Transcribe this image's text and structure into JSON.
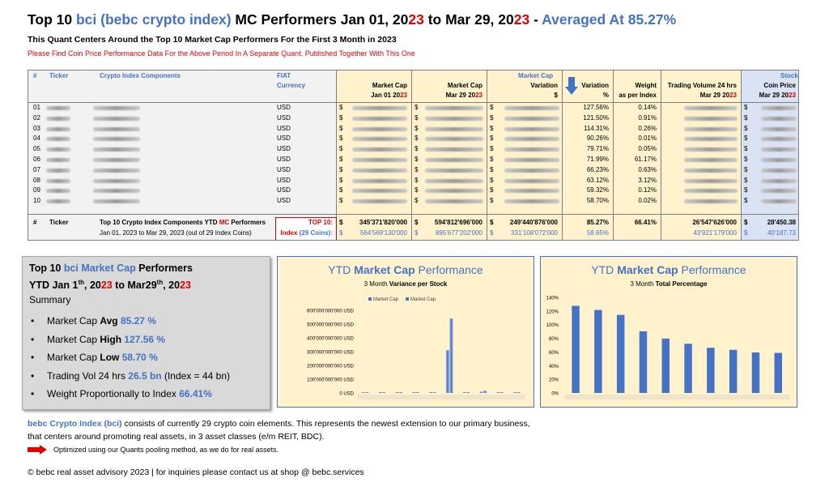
{
  "title": {
    "part1": "Top 10 ",
    "bci": "bci (bebc crypto index)",
    "part2": " MC Performers Jan 01, 20",
    "y1": "23",
    "part3": " to Mar 29, 20",
    "y2": "23",
    "part4": " - ",
    "avg": "Averaged At 85.27%"
  },
  "subtitle": "This Quant Centers Around the Top 10 Market Cap Performers For the First 3 Month in 2023",
  "note": "Please Find Coin Price Performance Data For the Above Period In A Separate Quant, Published Together With This One",
  "table": {
    "h_num": "#",
    "h_ticker": "Ticker",
    "h_components": "Crypto Index Components",
    "h_fiat1": "FIAT",
    "h_fiat2": "Currency",
    "h_group_mc": "Market Cap",
    "h_mc_jan1": "Market Cap",
    "h_mc_jan2a": "Jan 01 20",
    "h_mc_jan2b": "23",
    "h_mc_mar1": "Market Cap",
    "h_mc_mar2a": "Mar 29 20",
    "h_mc_mar2b": "23",
    "h_var_abs1": "Variation",
    "h_var_abs2": "$",
    "h_var_pct1": "Variation",
    "h_var_pct2": "%",
    "h_weight1": "Weight",
    "h_weight2": "as per Index",
    "h_vol1": "Trading Volume 24 hrs",
    "h_vol2a": "Mar 29 20",
    "h_vol2b": "23",
    "h_stock": "Stock",
    "h_price1": "Coin Price",
    "h_price2a": "Mar 29 20",
    "h_price2b": "23",
    "currency_sign": "$",
    "rows": [
      {
        "num": "01",
        "fiat": "USD",
        "var": "127.56%",
        "weight": "0.14%"
      },
      {
        "num": "02",
        "fiat": "USD",
        "var": "121.50%",
        "weight": "0.91%"
      },
      {
        "num": "03",
        "fiat": "USD",
        "var": "114.31%",
        "weight": "0.26%"
      },
      {
        "num": "04",
        "fiat": "USD",
        "var": "90.26%",
        "weight": "0.01%"
      },
      {
        "num": "05",
        "fiat": "USD",
        "var": "79.71%",
        "weight": "0.05%"
      },
      {
        "num": "06",
        "fiat": "USD",
        "var": "71.99%",
        "weight": "61.17%"
      },
      {
        "num": "07",
        "fiat": "USD",
        "var": "66.23%",
        "weight": "0.63%"
      },
      {
        "num": "08",
        "fiat": "USD",
        "var": "63.12%",
        "weight": "3.12%"
      },
      {
        "num": "09",
        "fiat": "USD",
        "var": "59.32%",
        "weight": "0.12%"
      },
      {
        "num": "10",
        "fiat": "USD",
        "var": "58.70%",
        "weight": "0.02%"
      }
    ],
    "foot_num": "#",
    "foot_ticker": "Ticker",
    "foot_desc1a": "Top 10 Crypto Index Components YTD ",
    "foot_desc1b": "MC",
    "foot_desc1c": " Performers",
    "foot_desc2": "Jan 01, 2023 to Mar 29, 2023 (out of 29 Index Coins)",
    "top10_label": "TOP 10:",
    "top10": {
      "mc_jan": "345'371'820'000",
      "mc_mar": "594'812'696'000",
      "var_abs": "249'440'876'000",
      "var_pct": "85.27%",
      "weight": "66.41%",
      "volume": "26'547'626'000",
      "price": "28'450.38"
    },
    "index_label_a": "Index",
    "index_label_b": "(29 Coins):",
    "index": {
      "mc_jan": "564'569'130'000",
      "mc_mar": "895'677'202'000",
      "var_abs": "331'108'072'000",
      "var_pct": "58.65%",
      "volume": "43'921'179'000",
      "price": "40'187.73"
    }
  },
  "summary": {
    "h1a": "Top 10 ",
    "h1b": "bci",
    "h1c": " Market Cap",
    "h1d": " Performers",
    "h2a": "YTD Jan 1",
    "h2a_sup": "th",
    "h2b": ", 20",
    "h2b_red": "23",
    "h2c": " to Mar29",
    "h2c_sup": "th",
    "h2d": ", 20",
    "h2d_red": "23",
    "label": "Summary",
    "bullets": [
      {
        "pre": "Market Cap ",
        "bold": "Avg",
        "val": "85.27 %",
        "post": ""
      },
      {
        "pre": "Market Cap ",
        "bold": "High",
        "val": "127.56 %",
        "post": ""
      },
      {
        "pre": "Market Cap ",
        "bold": "Low",
        "val": "58.70 %",
        "post": ""
      },
      {
        "pre": "Trading Vol 24 hrs ",
        "bold": "",
        "val": "26.5 bn",
        "post": " (Index = 44 bn)"
      },
      {
        "pre": "Weight Proportionally  to Index ",
        "bold": "",
        "val": "66.41%",
        "post": ""
      }
    ]
  },
  "chart_data": [
    {
      "type": "bar",
      "title": "YTD Market Cap Performance",
      "subtitle": "3 Month Variance per Stock",
      "legend": [
        "Market Cap",
        "Market Cap"
      ],
      "yticks": [
        "0 USD",
        "100'000'000'000 USD",
        "200'000'000'000 USD",
        "300'000'000'000 USD",
        "400'000'000'000 USD",
        "500'000'000'000 USD",
        "600'000'000'000 USD"
      ],
      "ylim": [
        0,
        600000000000
      ],
      "series": [
        {
          "values": [
            2000000000,
            1500000000,
            1000000000,
            800000000,
            1000000000,
            310000000000,
            2000000000,
            9000000000,
            1500000000,
            1000000000
          ]
        },
        {
          "values": [
            3000000000,
            2500000000,
            2000000000,
            1500000000,
            2000000000,
            540000000000,
            3000000000,
            16000000000,
            2500000000,
            2000000000
          ]
        }
      ]
    },
    {
      "type": "bar",
      "title": "YTD Market Cap Performance",
      "subtitle": "3 Month Total Percentage",
      "yticks": [
        "0%",
        "20%",
        "40%",
        "60%",
        "80%",
        "100%",
        "120%",
        "140%"
      ],
      "ylim": [
        0,
        140
      ],
      "values": [
        127.56,
        121.5,
        114.31,
        90.26,
        79.71,
        71.99,
        66.23,
        63.12,
        59.32,
        58.7
      ]
    }
  ],
  "chart_title_parts": {
    "pre": "YTD ",
    "bold": "Market Cap",
    "post": " Performance"
  },
  "chart1_sub_parts": {
    "pre": "3 Month ",
    "bold": "Variance per Stock"
  },
  "chart2_sub_parts": {
    "pre": "3 Month ",
    "bold": "Total Percentage"
  },
  "footer": {
    "line1a": "bebc Crypto Index (bci)",
    "line1b": " consists of currently 29 crypto coin elements. This represents the newest extension to our primary business,",
    "line2": "that centers around promoting real assets, in 3 asset classes (e/m REIT, BDC).",
    "note": "Optimized using our Quants pooling method, as we do for real assets.",
    "copyright": "© bebc real asset advisory 2023 | for inquiries please contact us at shop @ bebc.services"
  },
  "colors": {
    "blue": "#4472c4",
    "red": "#e00000",
    "yellow": "#fff2cc",
    "stock": "#dae3f3",
    "gray": "#d9d9d9"
  }
}
